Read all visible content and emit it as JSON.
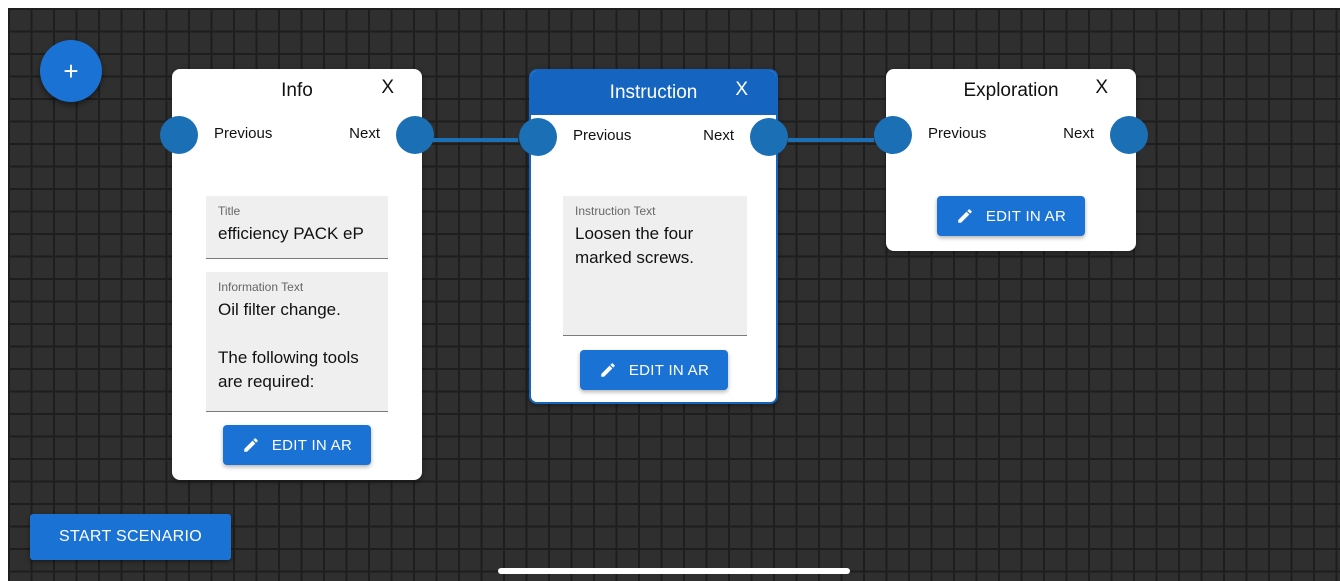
{
  "toolbar": {
    "add_label": "+",
    "start_label": "START SCENARIO"
  },
  "nodes": [
    {
      "title": "Info",
      "close_label": "X",
      "previous_label": "Previous",
      "next_label": "Next",
      "fields": [
        {
          "label": "Title",
          "value": "efficiency PACK eP"
        },
        {
          "label": "Information Text",
          "value": "Oil filter change.\n\nThe following tools are required:"
        }
      ],
      "edit_label": "EDIT IN AR"
    },
    {
      "title": "Instruction",
      "close_label": "X",
      "previous_label": "Previous",
      "next_label": "Next",
      "selected": true,
      "fields": [
        {
          "label": "Instruction Text",
          "value": "Loosen the four marked screws."
        }
      ],
      "edit_label": "EDIT IN AR"
    },
    {
      "title": "Exploration",
      "close_label": "X",
      "previous_label": "Previous",
      "next_label": "Next",
      "edit_label": "EDIT IN AR"
    }
  ],
  "colors": {
    "accent": "#1a73d4",
    "port": "#1a6fb5",
    "selected_header": "#1565c0",
    "canvas": "#2f2f2f"
  },
  "icons": {
    "add": "plus-icon",
    "edit": "pencil-icon"
  }
}
